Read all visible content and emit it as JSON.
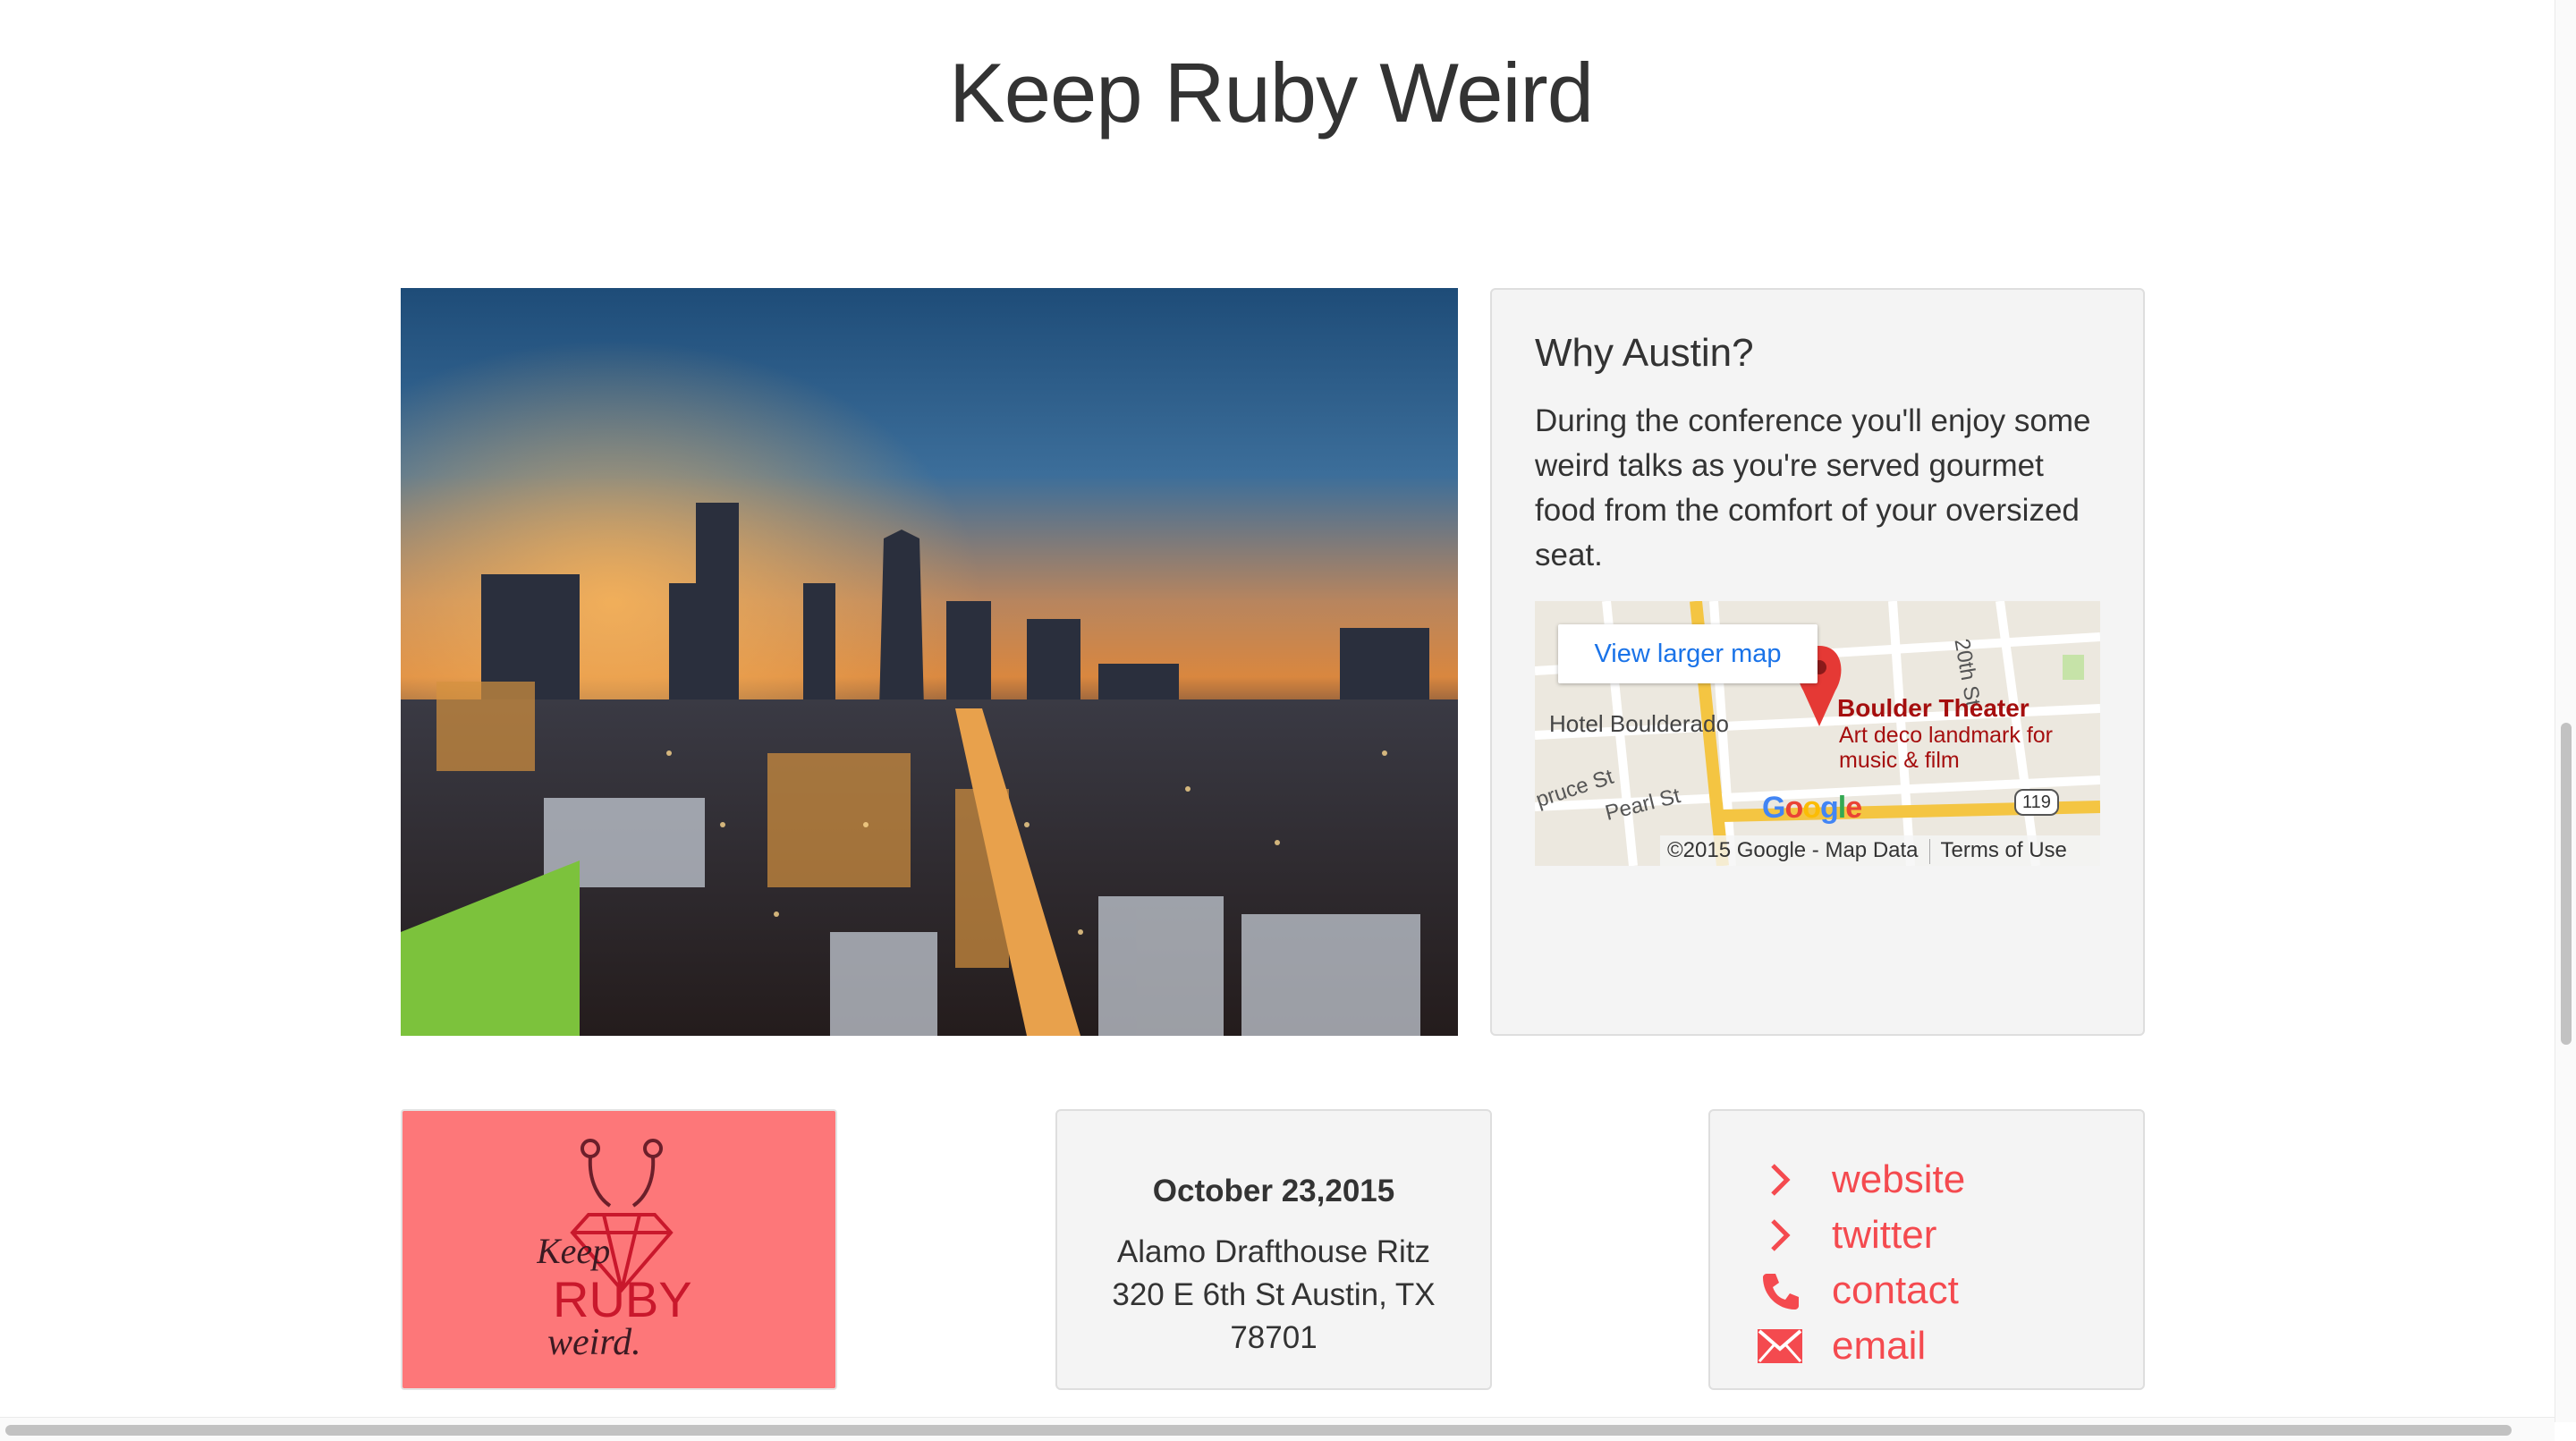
{
  "header": {
    "title": "Keep Ruby Weird"
  },
  "why_austin": {
    "title": "Why Austin?",
    "text": "During the conference you'll enjoy some weird talks as you're served gourmet food from the comfort of your oversized seat."
  },
  "map": {
    "view_larger_label": "View larger map",
    "hotel_label": "Hotel Boulderado",
    "street_spruce": "pruce St",
    "street_pearl": "Pearl St",
    "street_20th": "20th St",
    "venue_name": "Boulder Theater",
    "venue_description": "Art deco landmark for music & film",
    "route_number": "119",
    "copyright": "©2015 Google - Map Data",
    "terms": "Terms of Use"
  },
  "event": {
    "date": "October 23,2015",
    "venue_line1": "Alamo Drafthouse Ritz",
    "venue_line2": "320 E 6th St Austin, TX",
    "venue_line3": "78701"
  },
  "links": [
    {
      "icon": "chevron-right-icon",
      "label": "website"
    },
    {
      "icon": "chevron-right-icon",
      "label": "twitter"
    },
    {
      "icon": "phone-icon",
      "label": "contact"
    },
    {
      "icon": "envelope-icon",
      "label": "email"
    }
  ],
  "logo": {
    "text_keep": "Keep",
    "text_ruby": "RUBY",
    "text_weird": "weird."
  },
  "colors": {
    "accent": "#f44a4f",
    "logo_bg": "#fd7779",
    "panel_bg": "#f4f4f4"
  }
}
